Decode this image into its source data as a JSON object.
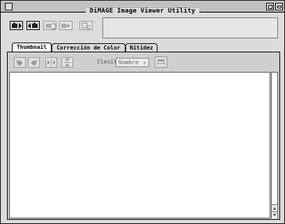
{
  "window": {
    "title": "DiMAGE Image Viewer Utility",
    "icons": [
      "close-box-icon",
      "zoom-box-icon",
      "collapse-box-icon"
    ]
  },
  "toolbar": {
    "buttons": [
      "camera-download-icon",
      "camera-upload-icon",
      "camera-rotate-icon",
      "camera-send-icon",
      "camera-settings-icon"
    ]
  },
  "tabs": [
    {
      "label": "Thumbnail",
      "active": true
    },
    {
      "label": "Corrección de Color",
      "active": false
    },
    {
      "label": "Nitidez",
      "active": false
    }
  ],
  "panel_toolbar": {
    "icons": [
      "rotate-left-icon",
      "rotate-right-icon",
      "flip-horizontal-icon",
      "flip-vertical-icon"
    ],
    "sort_label": "Clasificar",
    "sort_value": "Nombre",
    "sort_button_icon": "sort-order-icon"
  },
  "colors": {
    "window_bg": "#dcdcdc",
    "panel_bg": "#cfcfcf",
    "disabled_text": "#777777"
  }
}
